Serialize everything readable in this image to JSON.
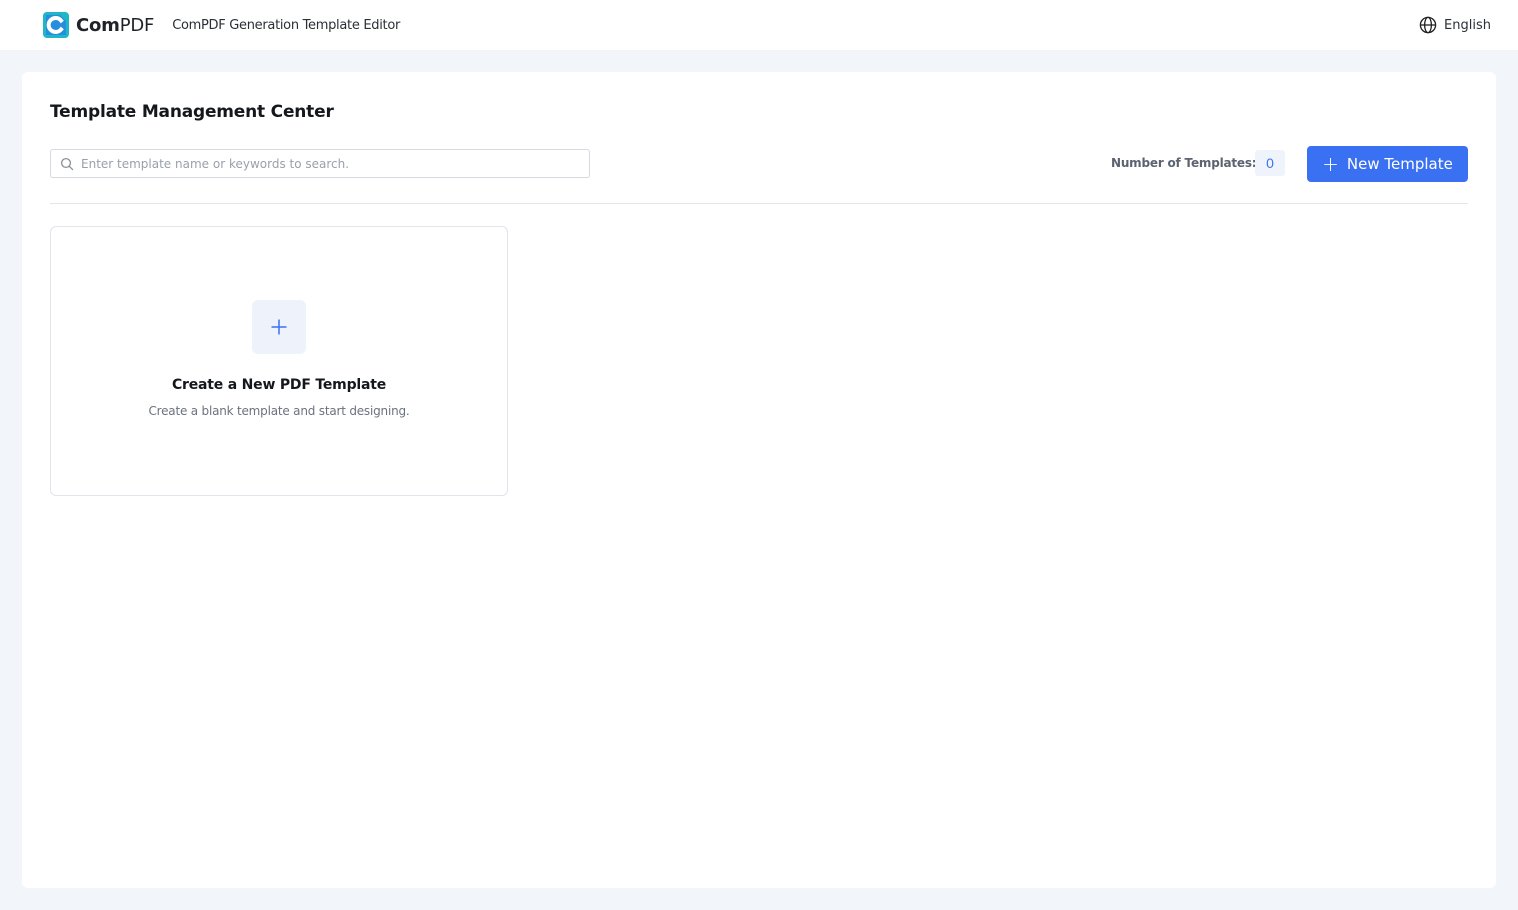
{
  "header": {
    "brand_name_bold": "Com",
    "brand_name_regular": "PDF",
    "app_title": "ComPDF Generation Template Editor",
    "language": "English",
    "logo_colors": {
      "primary": "#1fb7c6",
      "secondary": "#2f6bf0"
    }
  },
  "main": {
    "title": "Template Management Center",
    "search": {
      "placeholder": "Enter template name or keywords to search.",
      "value": ""
    },
    "template_count_label": "Number of Templates:",
    "template_count": "0",
    "new_template_label": "New Template"
  },
  "cards": [
    {
      "title": "Create a New PDF Template",
      "subtitle": "Create a blank template and start designing.",
      "icon": "plus-icon"
    }
  ],
  "colors": {
    "accent": "#3a71f2",
    "background": "#f2f5fa",
    "panel": "#ffffff"
  }
}
